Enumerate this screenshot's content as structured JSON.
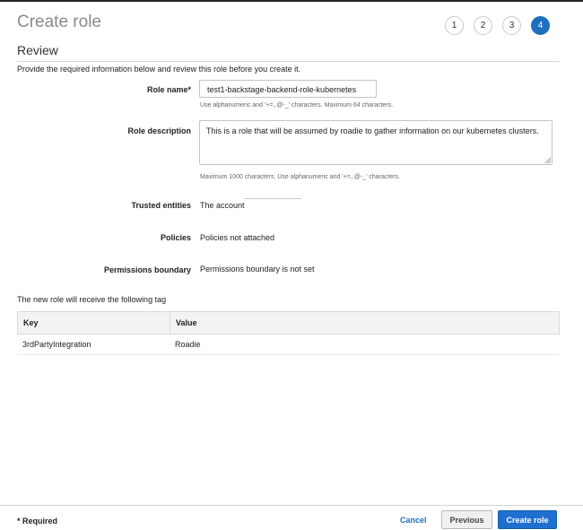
{
  "page": {
    "title": "Create role",
    "subtitle": "Review",
    "intro": "Provide the required information below and review this role before you create it."
  },
  "steps": [
    {
      "label": "1",
      "active": false
    },
    {
      "label": "2",
      "active": false
    },
    {
      "label": "3",
      "active": false
    },
    {
      "label": "4",
      "active": true
    }
  ],
  "role_name": {
    "label": "Role name*",
    "value": "test1-backstage-backend-role-kubernetes",
    "hint": "Use alphanumeric and '+=,.@-_' characters. Maximum 64 characters."
  },
  "role_description": {
    "label": "Role description",
    "value": "This is a role that will be assumed by roadie to gather information on our kubernetes clusters.",
    "hint": "Maximum 1000 characters. Use alphanumeric and '+=,.@-_' characters."
  },
  "trusted_entities": {
    "label": "Trusted entities",
    "value": "The account"
  },
  "policies": {
    "label": "Policies",
    "value": "Policies not attached"
  },
  "permissions_boundary": {
    "label": "Permissions boundary",
    "value": "Permissions boundary is not set"
  },
  "tags": {
    "note": "The new role will receive the following tag",
    "headers": {
      "key": "Key",
      "value": "Value"
    },
    "rows": [
      {
        "key": "3rdPartyIntegration",
        "value": "Roadie"
      }
    ]
  },
  "footer": {
    "required": "* Required",
    "cancel": "Cancel",
    "previous": "Previous",
    "create": "Create role"
  },
  "colors": {
    "accent": "#1f6fd1",
    "link": "#1f6fbf"
  }
}
